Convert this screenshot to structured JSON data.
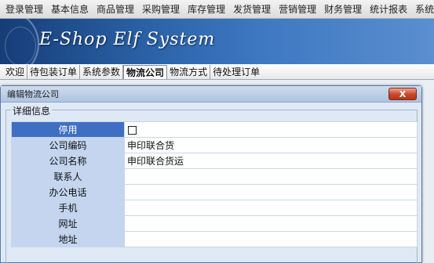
{
  "menu": {
    "items": [
      "登录管理",
      "基本信息",
      "商品管理",
      "采购管理",
      "库存管理",
      "发货管理",
      "营销管理",
      "财务管理",
      "统计报表",
      "系统管"
    ]
  },
  "banner": {
    "title": "E-Shop Elf System"
  },
  "tabs": [
    {
      "label": "欢迎",
      "active": false
    },
    {
      "label": "待包装订单",
      "active": false
    },
    {
      "label": "系统参数",
      "active": false
    },
    {
      "label": "物流公司",
      "active": true
    },
    {
      "label": "物流方式",
      "active": false
    },
    {
      "label": "待处理订单",
      "active": false
    }
  ],
  "dialog": {
    "title": "编辑物流公司",
    "close_label": "X",
    "group_label": "详细信息",
    "fields": [
      {
        "label": "停用",
        "value": "",
        "type": "checkbox",
        "checked": false,
        "selected": true
      },
      {
        "label": "公司编码",
        "value": "申印联合货"
      },
      {
        "label": "公司名称",
        "value": "申印联合货运"
      },
      {
        "label": "联系人",
        "value": ""
      },
      {
        "label": "办公电话",
        "value": ""
      },
      {
        "label": "手机",
        "value": ""
      },
      {
        "label": "网址",
        "value": ""
      },
      {
        "label": "地址",
        "value": ""
      }
    ]
  },
  "colors": {
    "selected_label_bg": "#3f6fc2",
    "label_bg": "#c3d5ef",
    "dialog_bg": "#dfe9f6",
    "close_button": "#c7472b"
  }
}
